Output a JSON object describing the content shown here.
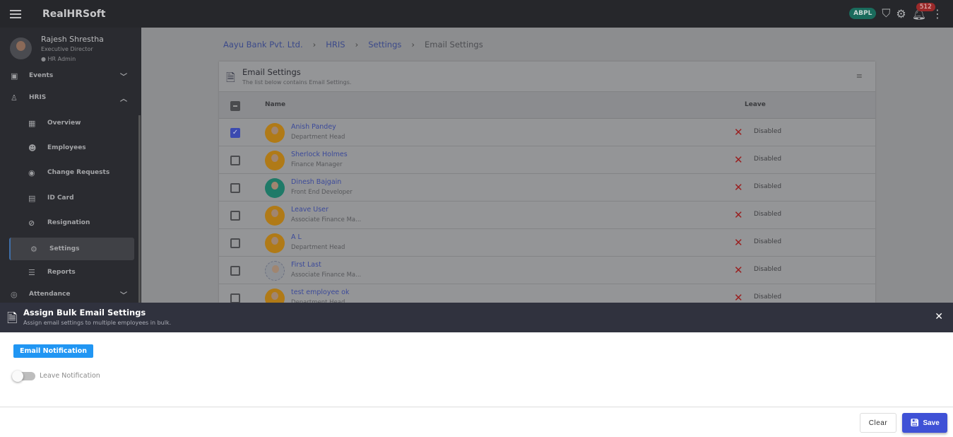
{
  "app": {
    "title": "RealHRSoft",
    "org_badge": "ABPL",
    "notification_count": "512"
  },
  "user": {
    "name": "Rajesh Shrestha",
    "role": "Executive Director",
    "admin": "HR Admin"
  },
  "sidebar": {
    "items": [
      {
        "label": "Events",
        "icon": "events-icon",
        "chevron": "down"
      },
      {
        "label": "HRIS",
        "icon": "person-icon",
        "chevron": "up"
      },
      {
        "label": "Overview",
        "icon": "dashboard-icon",
        "sub": true
      },
      {
        "label": "Employees",
        "icon": "people-icon",
        "sub": true
      },
      {
        "label": "Change Requests",
        "icon": "check-circle-icon",
        "sub": true
      },
      {
        "label": "ID Card",
        "icon": "id-card-icon",
        "sub": true
      },
      {
        "label": "Resignation",
        "icon": "person-off-icon",
        "sub": true
      },
      {
        "label": "Settings",
        "icon": "gear-icon",
        "sub": true,
        "active": true
      },
      {
        "label": "Reports",
        "icon": "reports-icon",
        "sub": true
      },
      {
        "label": "Attendance",
        "icon": "fingerprint-icon",
        "chevron": "down"
      }
    ]
  },
  "breadcrumb": [
    "Aayu Bank Pvt. Ltd.",
    "HRIS",
    "Settings",
    "Email Settings"
  ],
  "card": {
    "title": "Email Settings",
    "subtitle": "The list below contains Email Settings.",
    "columns": {
      "name": "Name",
      "leave": "Leave"
    }
  },
  "rows": [
    {
      "name": "Anish Pandey",
      "desc": "Department Head",
      "leave": "Disabled",
      "checked": true
    },
    {
      "name": "Sherlock Holmes",
      "desc": "Finance Manager",
      "leave": "Disabled"
    },
    {
      "name": "Dinesh Bajgain",
      "desc": "Front End Developer",
      "leave": "Disabled",
      "avatar": "green"
    },
    {
      "name": "Leave User",
      "desc": "Associate Finance Ma...",
      "leave": "Disabled"
    },
    {
      "name": "A L",
      "desc": "Department Head",
      "leave": "Disabled"
    },
    {
      "name": "First Last",
      "desc": "Associate Finance Ma...",
      "leave": "Disabled",
      "avatar": "logo"
    },
    {
      "name": "test employee ok",
      "desc": "Department Head",
      "leave": "Disabled"
    }
  ],
  "sheet": {
    "title": "Assign Bulk Email Settings",
    "subtitle": "Assign email settings to multiple employees in bulk.",
    "tab": "Email Notification",
    "toggle_label": "Leave Notification",
    "toggle_on": false,
    "clear": "Clear",
    "save": "Save"
  },
  "colors": {
    "accent": "#3f51d6",
    "tab": "#2196f3",
    "danger": "#9a2020"
  }
}
